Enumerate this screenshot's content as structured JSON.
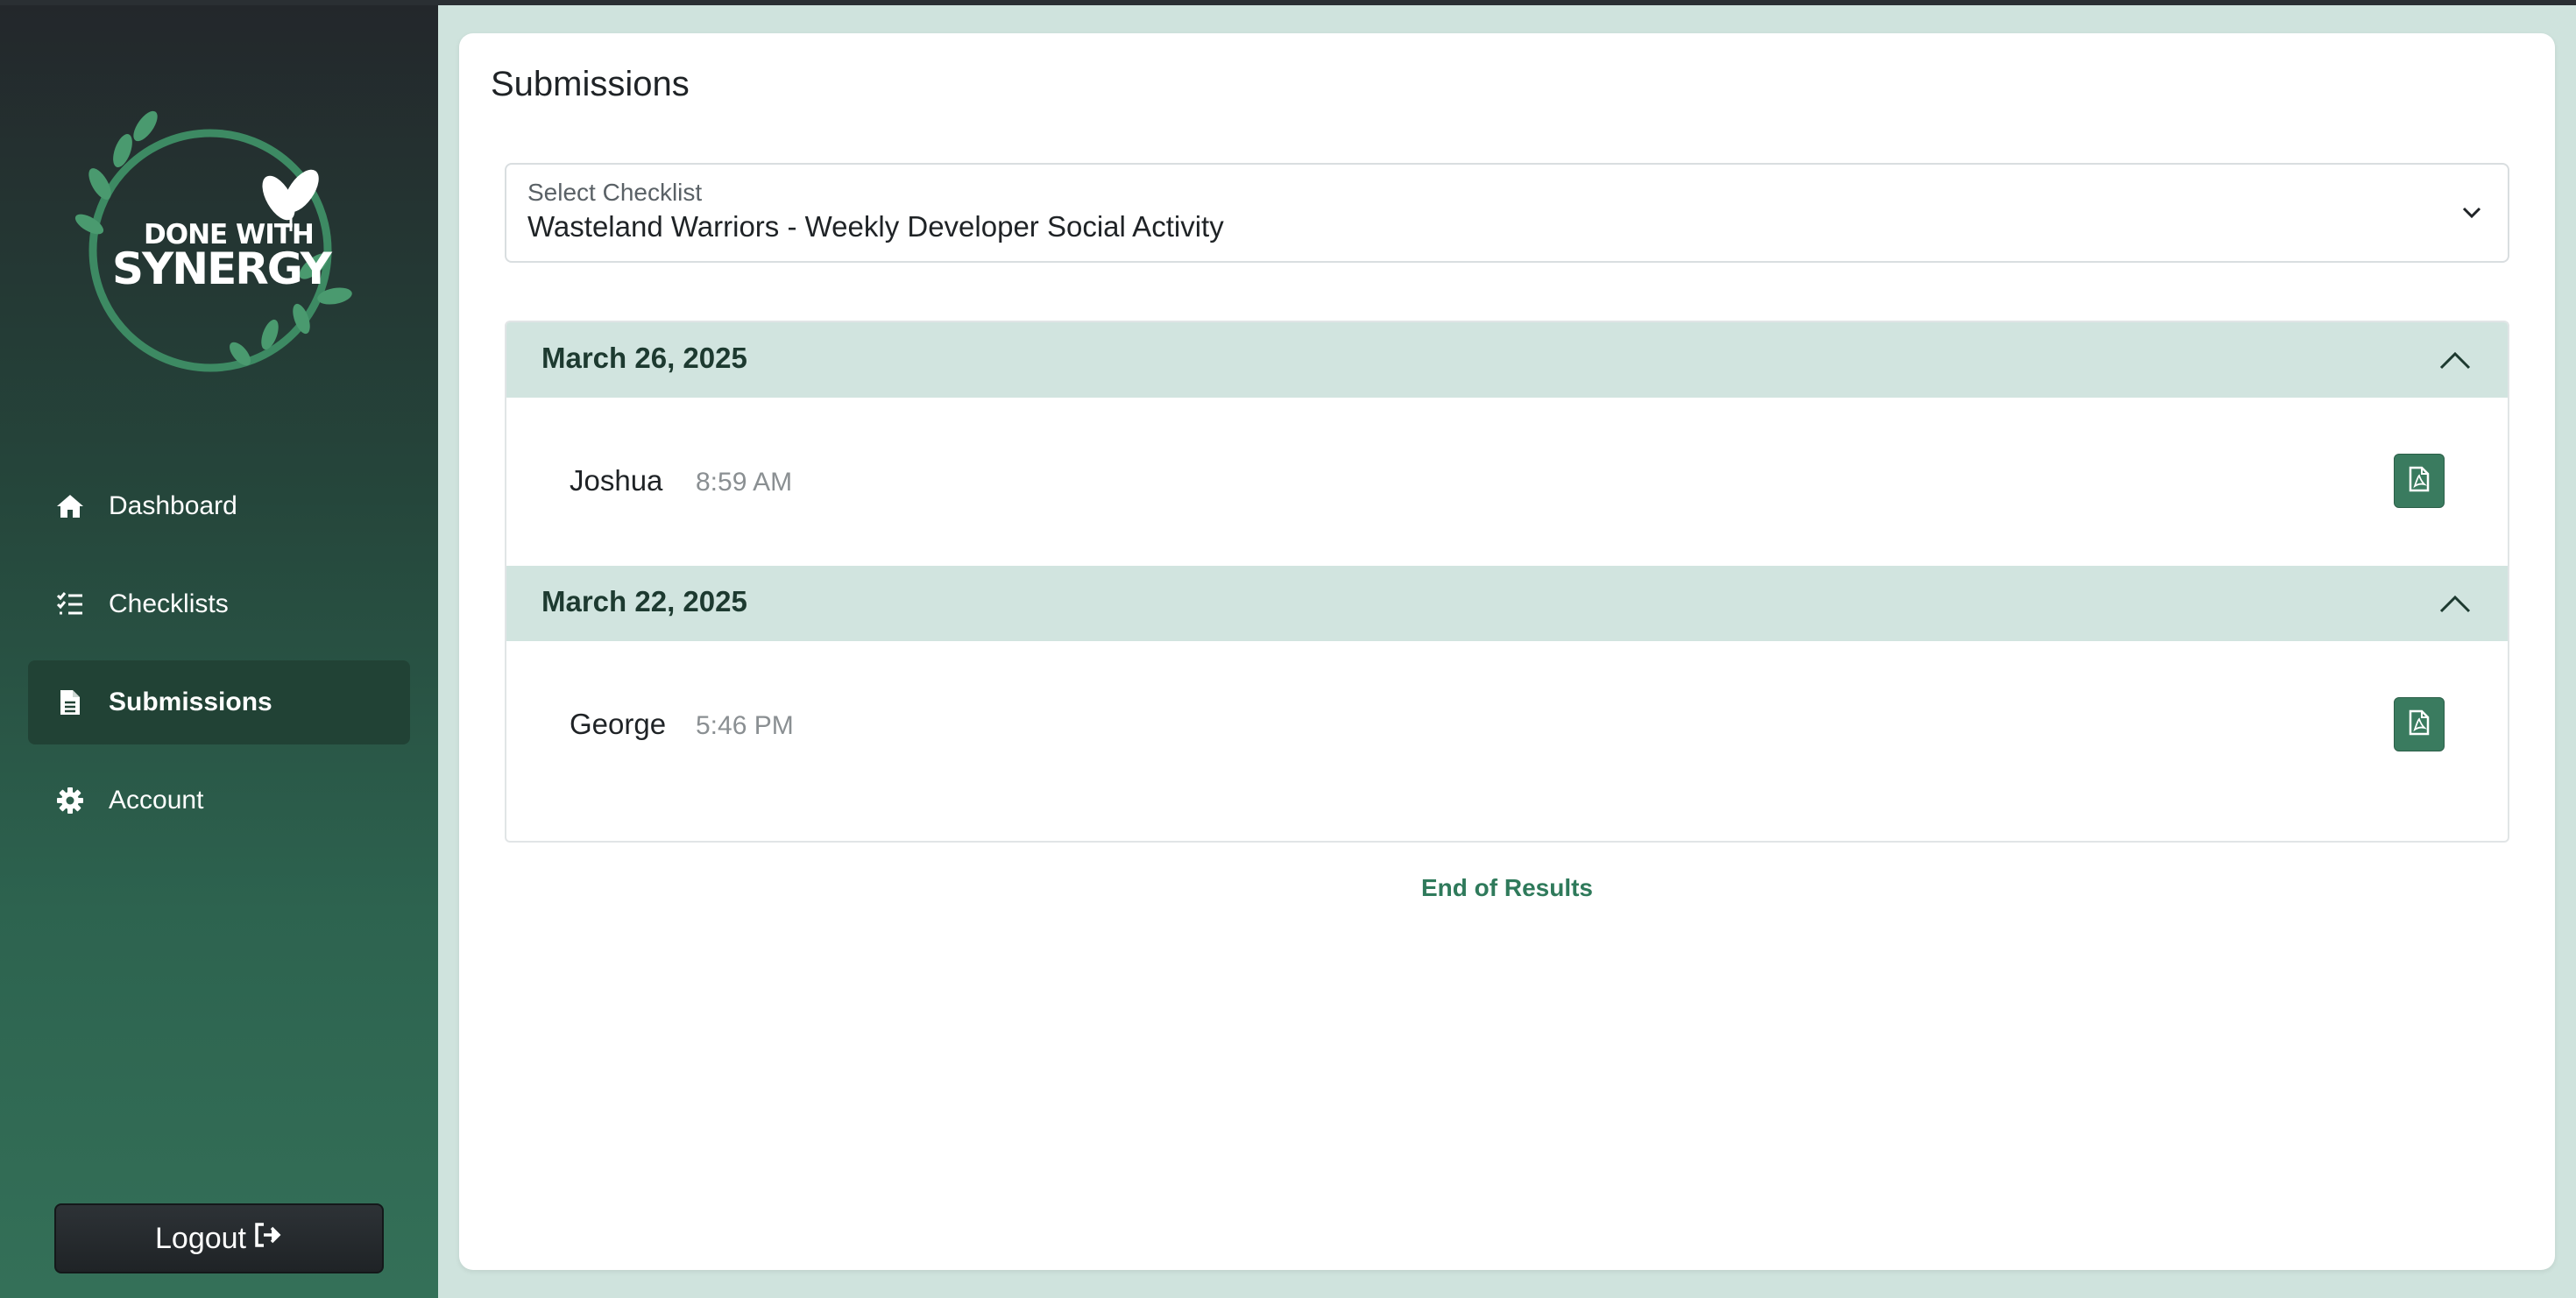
{
  "sidebar": {
    "brand": {
      "line1": "DONE WITH",
      "line2": "SYNERGY"
    },
    "items": [
      {
        "label": "Dashboard",
        "icon": "home-icon"
      },
      {
        "label": "Checklists",
        "icon": "list-check-icon"
      },
      {
        "label": "Submissions",
        "icon": "document-icon",
        "active": true
      },
      {
        "label": "Account",
        "icon": "gear-icon"
      }
    ],
    "logout_label": "Logout"
  },
  "main": {
    "title": "Submissions",
    "checklist_select": {
      "label": "Select Checklist",
      "value": "Wasteland Warriors - Weekly Developer Social Activity"
    },
    "groups": [
      {
        "date": "March 26, 2025",
        "submissions": [
          {
            "name": "Joshua",
            "time": "8:59 AM"
          }
        ]
      },
      {
        "date": "March 22, 2025",
        "submissions": [
          {
            "name": "George",
            "time": "5:46 PM"
          }
        ]
      }
    ],
    "end_label": "End of Results"
  },
  "colors": {
    "accent": "#3a7b5f",
    "group_header_bg": "#d1e4df",
    "sidebar_active_bg": "#214235",
    "end_text": "#2f7a5b"
  }
}
